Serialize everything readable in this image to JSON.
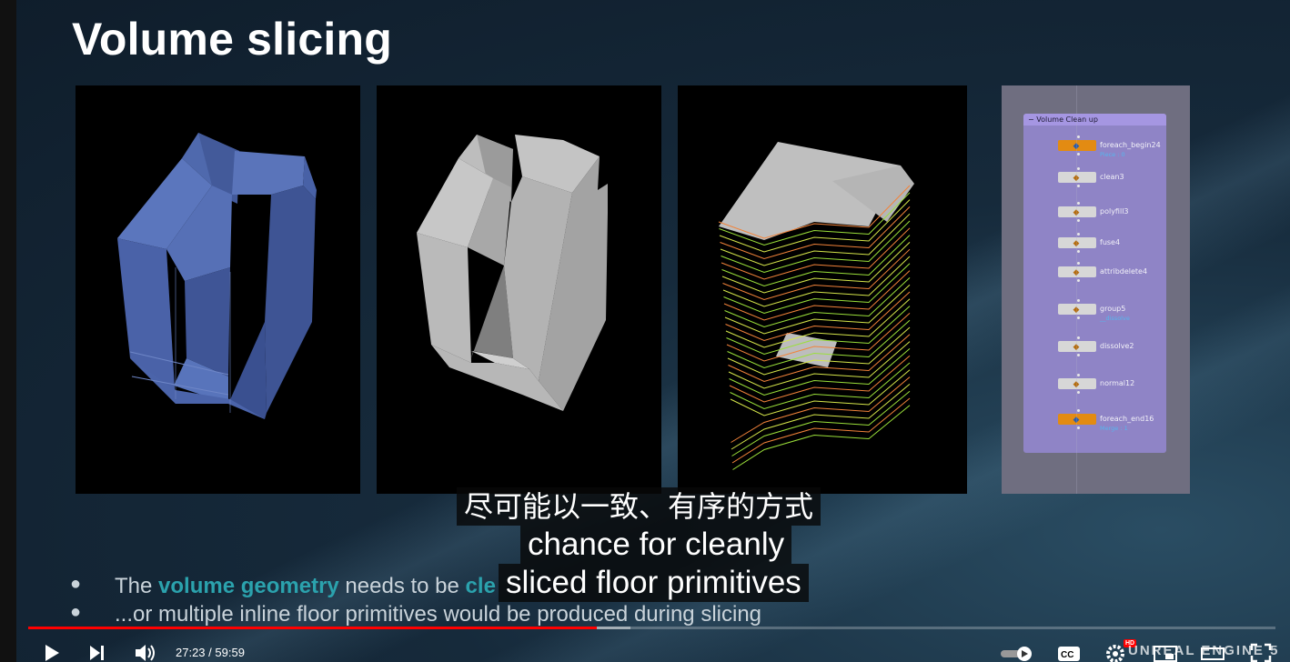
{
  "slide": {
    "title": "Volume slicing",
    "bullets": [
      {
        "pre": "The ",
        "hl1": "volume geometry",
        "mid": " needs to be ",
        "hl2": "cle"
      },
      {
        "text": "...or multiple inline floor primitives would be produced during slicing"
      }
    ]
  },
  "node_graph": {
    "frame_title": "Volume Clean up",
    "nodes": [
      {
        "label": "foreach_begin24",
        "sub": "Piece : 0"
      },
      {
        "label": "clean3"
      },
      {
        "label": "polyfill3"
      },
      {
        "label": "fuse4"
      },
      {
        "label": "attribdelete4"
      },
      {
        "label": "group5",
        "sub": "__dissolve"
      },
      {
        "label": "dissolve2"
      },
      {
        "label": "normal12"
      },
      {
        "label": "foreach_end16",
        "sub": "Merge : 1"
      }
    ]
  },
  "captions": {
    "line1": "尽可能以一致、有序的方式",
    "line2": "chance for cleanly",
    "line3": "sliced floor primitives"
  },
  "player": {
    "current_time": "27:23",
    "duration": "59:59",
    "time_separator": " / ",
    "played_fraction": 0.456,
    "buffered_fraction": 0.483,
    "hd_badge": "HD",
    "watermark": "UNREAL ENGINE 5",
    "colors": {
      "progress": "#ff0000",
      "accent": "#2ba2ad"
    }
  }
}
